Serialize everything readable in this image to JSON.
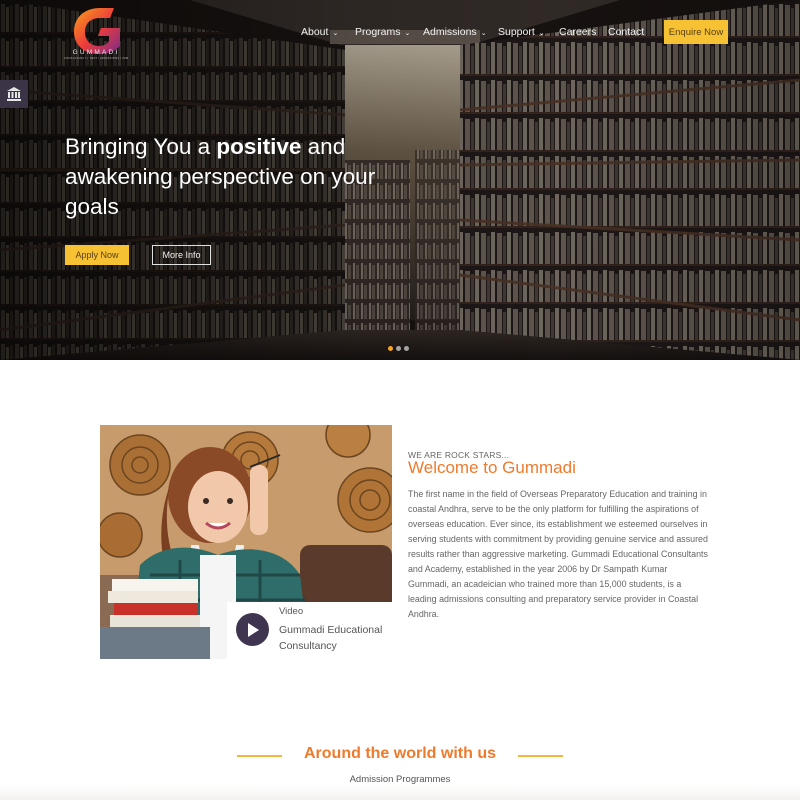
{
  "brand": {
    "name": "GUMMADI",
    "tagline": "CONSULTANCY | TEST | ADMISSIONS | IMMIGRATION",
    "colors": {
      "accent": "#f6c233",
      "orange": "#f07a2c",
      "purple": "#3f3550"
    }
  },
  "nav": {
    "items": [
      {
        "label": "About",
        "has_dropdown": true
      },
      {
        "label": "Programs",
        "has_dropdown": true
      },
      {
        "label": "Admissions",
        "has_dropdown": true
      },
      {
        "label": "Support",
        "has_dropdown": true
      },
      {
        "label": "Careers",
        "has_dropdown": false
      },
      {
        "label": "Contact",
        "has_dropdown": false
      }
    ],
    "cta_label": "Enquire Now",
    "chevron": "⌄"
  },
  "side_tab": {
    "icon": "institution-icon"
  },
  "hero": {
    "title_before": "Bringing You a ",
    "title_bold": "positive",
    "title_after": " and awakening perspective on your goals",
    "primary_button": "Apply Now",
    "secondary_button": "More Info",
    "slides": 3,
    "active_slide": 1
  },
  "welcome": {
    "kicker": "WE ARE ROCK STARS...",
    "title": "Welcome to Gummadi",
    "body": "The first name in the field of Overseas Preparatory Education and training in coastal Andhra, serve to be the only platform for fulfilling the aspirations of overseas education. Ever since, its establishment we esteemed ourselves in serving students with commitment by providing genuine service and assured results rather than aggressive marketing. Gummadi Educational Consultants and Academy, established in the year 2006 by Dr Sampath Kumar Gummadi, an acadeician who trained more than 15,000 students, is a leading admissions consulting and preparatory service provider in Coastal Andhra.",
    "video_label": "Video",
    "video_title": "Gummadi Educational Consultancy"
  },
  "world": {
    "title": "Around the world with us",
    "subtitle": "Admission Programmes"
  }
}
